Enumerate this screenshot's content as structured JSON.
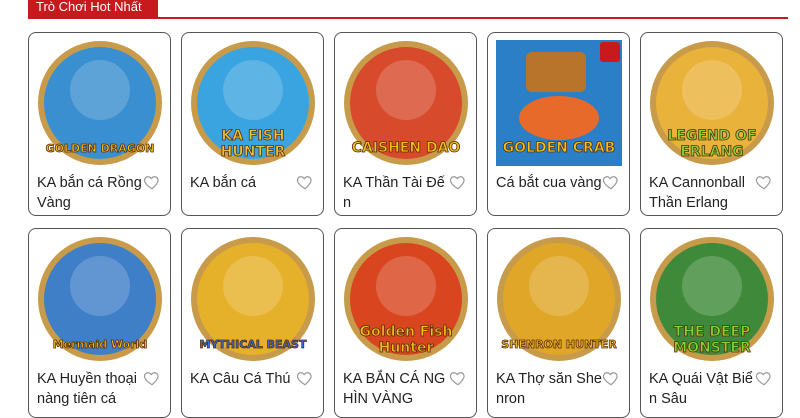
{
  "section": {
    "title": "Trò Chơi Hot Nhất"
  },
  "games": [
    {
      "name": "KA bắn cá Rồng Vàng",
      "logo": "GOLDEN DRAGON",
      "bg": "#3a8fd0",
      "ring": "#c89b4a",
      "logoColor": "#f2c21a",
      "icon": "dragon-icon"
    },
    {
      "name": "KA bắn cá",
      "logo": "KA FISH HUNTER",
      "bg": "#3aa4e0",
      "ring": "#c89b4a",
      "logoColor": "#e8c43a",
      "icon": "shark-icon"
    },
    {
      "name": "KA Thần Tài Đến",
      "logo": "CAISHEN DAO",
      "bg": "#d84a2c",
      "ring": "#c89b4a",
      "logoColor": "#f2c21a",
      "icon": "caishen-icon"
    },
    {
      "name": "Cá bắt cua vàng",
      "logo": "GOLDEN CRAB",
      "bg": "#2a7fc6",
      "ring": "#2a7fc6",
      "logoColor": "#f2c21a",
      "icon": "crab-icon"
    },
    {
      "name": "KA Cannonball Thần Erlang",
      "logo": "LEGEND OF ERLANG",
      "bg": "#e9b23a",
      "ring": "#c89b4a",
      "logoColor": "#8bd43a",
      "icon": "erlang-icon"
    },
    {
      "name": "KA Huyền thoại nàng tiên cá",
      "logo": "Mermaid World",
      "bg": "#3f7fc8",
      "ring": "#c89b4a",
      "logoColor": "#f2c21a",
      "icon": "mermaid-icon"
    },
    {
      "name": "KA Câu Cá Thú",
      "logo": "MYTHICAL BEAST",
      "bg": "#e6b12a",
      "ring": "#c89b4a",
      "logoColor": "#3a6fe0",
      "icon": "beast-icon"
    },
    {
      "name": "KA BẮN CÁ NGHÌN VÀNG",
      "logo": "Golden Fish Hunter",
      "bg": "#d8451f",
      "ring": "#c89b4a",
      "logoColor": "#f2c21a",
      "icon": "goldfish-icon"
    },
    {
      "name": "KA Thợ săn Shenron",
      "logo": "SHENRON HUNTER",
      "bg": "#e0a628",
      "ring": "#c89b4a",
      "logoColor": "#f2c21a",
      "icon": "shenron-icon"
    },
    {
      "name": "KA Quái Vật Biển Sâu",
      "logo": "THE DEEP MONSTER",
      "bg": "#3f8a3a",
      "ring": "#c89b4a",
      "logoColor": "#7fd82a",
      "icon": "crocodile-icon"
    }
  ]
}
